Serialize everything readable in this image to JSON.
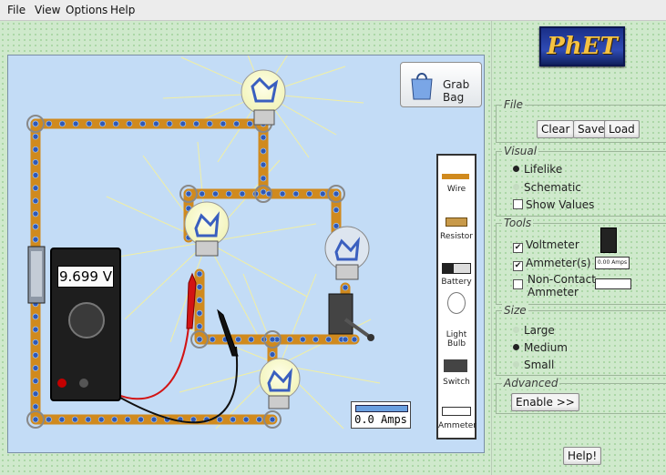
{
  "menu": {
    "items": [
      "File",
      "View",
      "Options",
      "Help"
    ]
  },
  "logo": {
    "text": "PhET"
  },
  "grab_bag": {
    "label": "Grab Bag"
  },
  "toolbox": {
    "items": [
      {
        "label": "Wire",
        "icon": "wire-icon"
      },
      {
        "label": "Resistor",
        "icon": "resistor-icon"
      },
      {
        "label": "Battery",
        "icon": "battery-icon"
      },
      {
        "label": "Light Bulb",
        "icon": "light-bulb-icon"
      },
      {
        "label": "Switch",
        "icon": "switch-icon"
      },
      {
        "label": "Ammeter",
        "icon": "ammeter-icon"
      }
    ]
  },
  "voltmeter": {
    "reading": "9.699 V"
  },
  "ammeter_probe": {
    "reading": "0.0 Amps"
  },
  "panel": {
    "file": {
      "title": "File",
      "buttons": [
        "Clear",
        "Save",
        "Load"
      ]
    },
    "visual": {
      "title": "Visual",
      "options": [
        "Lifelike",
        "Schematic"
      ],
      "selected": "Lifelike",
      "show_values": {
        "label": "Show Values",
        "checked": false
      }
    },
    "tools": {
      "title": "Tools",
      "voltmeter": {
        "label": "Voltmeter",
        "checked": true
      },
      "ammeter": {
        "label": "Ammeter(s)",
        "checked": true,
        "icon_reading": "0.00 Amps"
      },
      "non_contact": {
        "label_line1": "Non-Contact",
        "label_line2": "Ammeter",
        "checked": false
      }
    },
    "size": {
      "title": "Size",
      "options": [
        "Large",
        "Medium",
        "Small"
      ],
      "selected": "Medium"
    },
    "advanced": {
      "title": "Advanced",
      "button": "Enable >>"
    },
    "help": {
      "button": "Help!"
    }
  },
  "colors": {
    "wire": "#d08a1e",
    "electron": "#2f58b6",
    "canvas_bg": "#c3dcf6",
    "panel_bg": "#cfe9cc",
    "probe_red": "#d21414",
    "probe_black": "#111111"
  }
}
